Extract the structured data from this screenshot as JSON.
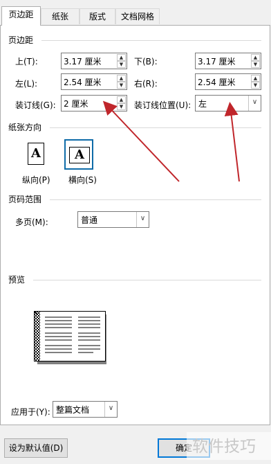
{
  "tabs": [
    "页边距",
    "纸张",
    "版式",
    "文档网格"
  ],
  "margins": {
    "section_title": "页边距",
    "top_label": "上(T):",
    "top_value": "3.17 厘米",
    "bottom_label": "下(B):",
    "bottom_value": "3.17 厘米",
    "left_label": "左(L):",
    "left_value": "2.54 厘米",
    "right_label": "右(R):",
    "right_value": "2.54 厘米",
    "gutter_label": "装订线(G):",
    "gutter_value": "2 厘米",
    "gutter_pos_label": "装订线位置(U):",
    "gutter_pos_value": "左"
  },
  "orientation": {
    "section_title": "纸张方向",
    "glyph": "A",
    "portrait_label": "纵向(P)",
    "landscape_label": "横向(S)",
    "selected": "landscape"
  },
  "pages": {
    "section_title": "页码范围",
    "multi_label": "多页(M):",
    "multi_value": "普通"
  },
  "preview": {
    "section_title": "预览"
  },
  "apply": {
    "label": "应用于(Y):",
    "value": "整篇文档"
  },
  "buttons": {
    "default_label": "设为默认值(D)",
    "ok_label": "确定"
  },
  "watermark": "软件技巧",
  "colors": {
    "annotation_arrow": "#c0262b",
    "selected_border": "#0e6ba8"
  }
}
